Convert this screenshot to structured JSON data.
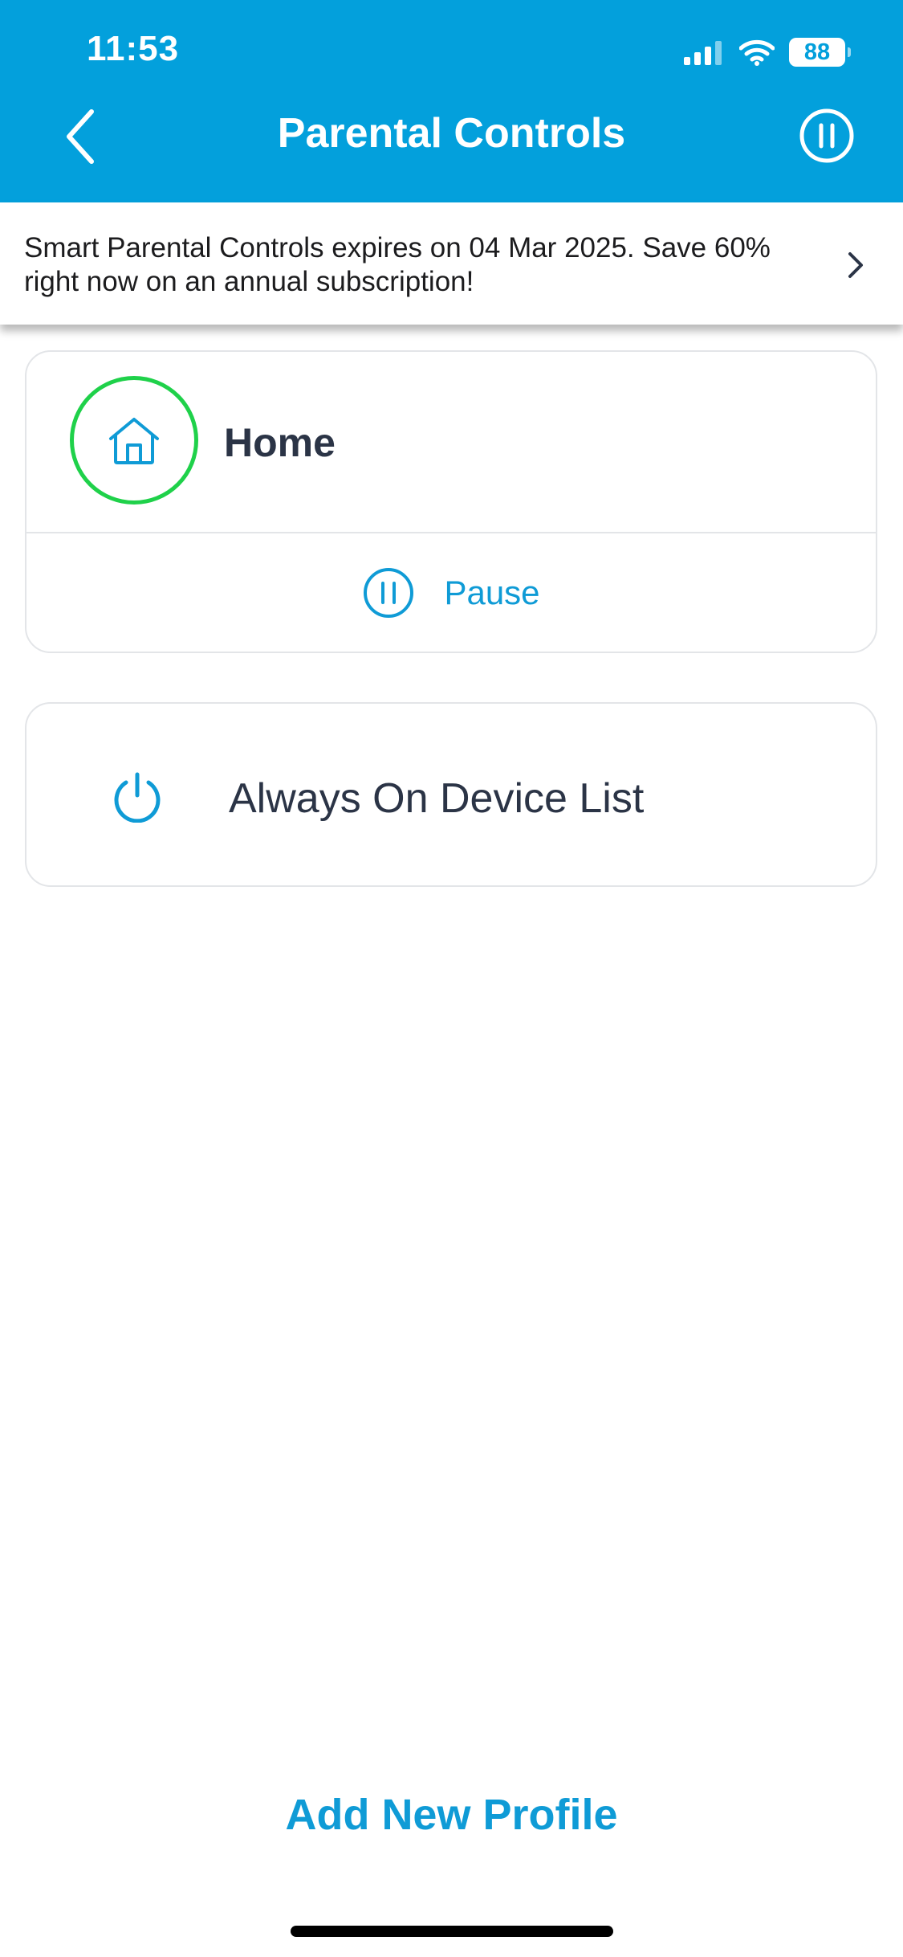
{
  "status_bar": {
    "time": "11:53",
    "battery": "88",
    "icons": [
      "signal-icon",
      "wifi-icon",
      "battery-icon"
    ]
  },
  "header": {
    "title": "Parental Controls",
    "back_icon": "chevron-left-icon",
    "action_icon": "pause-circle-icon",
    "background_color": "#03a0dc"
  },
  "banner": {
    "text": "Smart Parental Controls expires on 04 Mar 2025. Save 60% right now on an annual subscription!",
    "icon": "chevron-right-icon"
  },
  "profiles": [
    {
      "name": "Home",
      "icon": "home-icon",
      "ring_color": "#1fd14a",
      "action_label": "Pause",
      "action_icon": "pause-circle-icon"
    }
  ],
  "device_list": {
    "label": "Always On Device List",
    "icon": "power-icon"
  },
  "footer": {
    "add_profile_label": "Add New Profile",
    "accent_color": "#0f9bd6"
  }
}
